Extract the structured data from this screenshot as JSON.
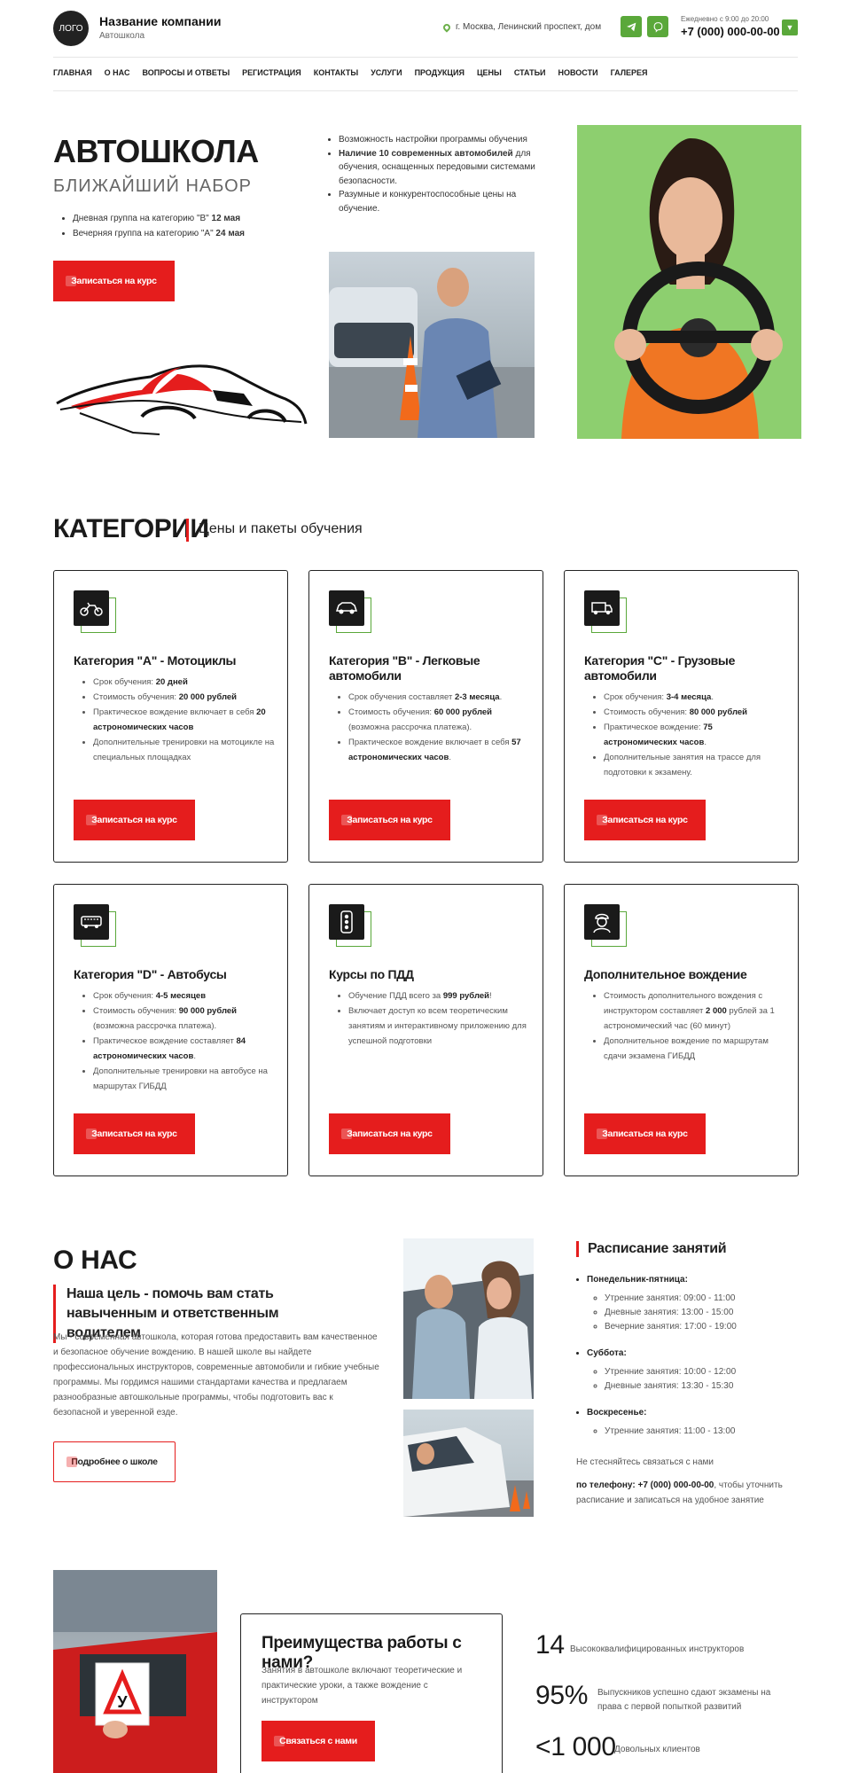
{
  "header": {
    "logo": "ЛОГО",
    "company_name": "Название компании",
    "company_sub": "Автошкола",
    "address": "г. Москва, Ленинский проспект, дом",
    "hours": "Ежедневно с 9:00 до 20:00",
    "phone": "+7 (000) 000-00-00",
    "icons": [
      "telegram-icon",
      "viber-icon",
      "chevron-down-icon"
    ],
    "accent_color": "#5aa83a"
  },
  "nav": [
    "Главная",
    "О нас",
    "Вопросы и ответы",
    "Регистрация",
    "Контакты",
    "Услуги",
    "Продукция",
    "Цены",
    "Статьи",
    "Новости",
    "Галерея"
  ],
  "hero": {
    "title": "АВТОШКОЛА",
    "subtitle": "БЛИЖАЙШИЙ НАБОР",
    "groups": [
      {
        "text": "Дневная группа на категорию \"B\" ",
        "bold": "12 мая"
      },
      {
        "text": "Вечерняя группа на категорию \"A\" ",
        "bold": "24 мая"
      }
    ],
    "button": "Записаться на курс",
    "bullets": [
      {
        "pre": "Возможность настройки программы обучения",
        "bold": "",
        "post": ""
      },
      {
        "pre": "",
        "bold": "Наличие 10 современных автомобилей",
        "post": " для обучения, оснащенных передовыми системами безопасности."
      },
      {
        "pre": "Разумные и конкурентоспособные цены на обучение.",
        "bold": "",
        "post": ""
      }
    ],
    "brand_color": "#e51d1d"
  },
  "categories": {
    "title": "КАТЕГОРИИ",
    "subtitle": "Цены и пакеты обучения",
    "button": "Записаться на курс",
    "cards": [
      {
        "icon": "motorcycle-icon",
        "title": "Категория \"А\" - Мотоциклы",
        "items": [
          [
            "Срок обучения: ",
            "20 дней",
            ""
          ],
          [
            "Стоимость обучения: ",
            "20 000 рублей",
            ""
          ],
          [
            "Практическое вождение включает в себя ",
            "20 астрономических часов",
            ""
          ],
          [
            "Дополнительные тренировки на мотоцикле на специальных площадках",
            "",
            ""
          ]
        ]
      },
      {
        "icon": "car-icon",
        "title": "Категория \"В\" - Легковые автомобили",
        "items": [
          [
            "Срок обучения составляет ",
            "2-3 месяца",
            "."
          ],
          [
            "Стоимость обучения: ",
            "60 000 рублей",
            " (возможна рассрочка платежа)."
          ],
          [
            "Практическое вождение включает в себя ",
            "57 астрономических часов",
            "."
          ]
        ]
      },
      {
        "icon": "truck-icon",
        "title": "Категория \"С\" - Грузовые автомобили",
        "items": [
          [
            "Срок обучения: ",
            "3-4 месяца",
            "."
          ],
          [
            "Стоимость обучения: ",
            "80 000 рублей",
            ""
          ],
          [
            "Практическое вождение: ",
            "75 астрономических часов",
            "."
          ],
          [
            "Дополнительные занятия на трассе для подготовки к экзамену.",
            "",
            ""
          ]
        ]
      },
      {
        "icon": "bus-icon",
        "title": "Категория \"D\" - Автобусы",
        "items": [
          [
            "Срок обучения: ",
            "4-5 месяцев",
            ""
          ],
          [
            "Стоимость обучения: ",
            "90 000 рублей",
            " (возможна рассрочка платежа)."
          ],
          [
            "Практическое вождение составляет ",
            "84 астрономических часов",
            "."
          ],
          [
            "Дополнительные тренировки на автобусе на маршрутах ГИБДД",
            "",
            ""
          ]
        ]
      },
      {
        "icon": "traffic-light-icon",
        "title": "Курсы по ПДД",
        "items": [
          [
            "Обучение ПДД всего за ",
            "999 рублей",
            "!"
          ],
          [
            "Включает доступ ко всем теоретическим занятиям и интерактивному приложению для успешной подготовки",
            "",
            ""
          ]
        ]
      },
      {
        "icon": "driver-icon",
        "title": "Дополнительное вождение",
        "items": [
          [
            "Стоимость дополнительного вождения с инструктором составляет ",
            "2 000",
            " рублей за 1 астрономический час (60 минут)"
          ],
          [
            "Дополнительное вождение по маршрутам сдачи экзамена ГИБДД",
            "",
            ""
          ]
        ]
      }
    ]
  },
  "about": {
    "title": "О НАС",
    "quote": "Наша цель - помочь вам стать навыченным и ответственным водителем",
    "text": "Мы - современная автошкола, которая готова предоставить вам качественное и безопасное обучение вождению. В нашей школе вы найдете профессиональных инструкторов, современные автомобили и гибкие учебные программы. Мы гордимся нашими стандартами качества и предлагаем разнообразные автошкольные программы, чтобы подготовить вас к безопасной и уверенной езде.",
    "button": "Подробнее о школе"
  },
  "schedule": {
    "title": "Расписание занятий",
    "days": [
      {
        "day": "Понедельник-пятница:",
        "slots": [
          "Утренние занятия: 09:00 - 11:00",
          "Дневные занятия: 13:00 - 15:00",
          "Вечерние занятия: 17:00 - 19:00"
        ]
      },
      {
        "day": "Суббота:",
        "slots": [
          "Утренние занятия: 10:00 - 12:00",
          "Дневные занятия: 13:30 - 15:30"
        ]
      },
      {
        "day": "Воскресенье:",
        "slots": [
          "Утренние занятия: 11:00 - 13:00"
        ]
      }
    ],
    "note": "Не стесняйтесь связаться с нами",
    "contact_bold": "по телефону: +7 (000) 000-00-00",
    "contact_rest": ", чтобы уточнить расписание и записаться на удобное занятие"
  },
  "advantages": {
    "title": "Преимущества работы с нами?",
    "text": "Занятия в автошколе включают теоретические и практические уроки, а также вождение с инструктором",
    "button": "Связаться с нами",
    "stats": [
      {
        "num": "14",
        "text": "Высококвалифицированных инструкторов"
      },
      {
        "num": "95%",
        "text": "Выпускников успешно сдают экзамены на права с первой попыткой развитий"
      },
      {
        "num": "<1 000",
        "text": "Довольных клиентов"
      }
    ]
  }
}
